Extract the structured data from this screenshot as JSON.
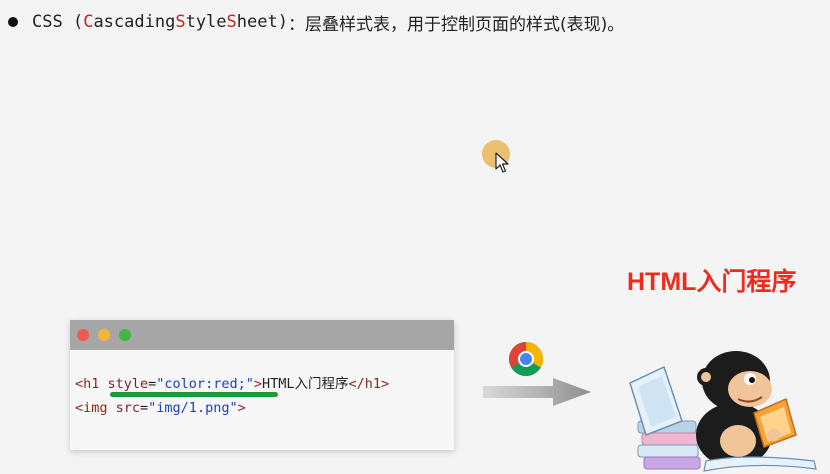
{
  "headline": {
    "parts": [
      "CSS (",
      "C",
      "ascading ",
      "S",
      "tyle ",
      "S",
      "heet)",
      "：层叠样式表，用于控制页面的样式(表现)。"
    ]
  },
  "demo": {
    "title": "HTML入门程序"
  },
  "editor": {
    "line1": {
      "open": "<h1 ",
      "attr": "style",
      "eq": "=",
      "value": "\"color:red;\"",
      "close": ">",
      "text": "HTML入门程序",
      "end": "</h1>"
    },
    "line2": {
      "open": "<img ",
      "attr": "src",
      "eq": "=",
      "value": "\"img/1.png\"",
      "close": ">"
    }
  },
  "colors": {
    "title_red": "#ef2b1f",
    "highlight_red": "#c0271f",
    "underline_green": "#1e9a3b",
    "string_blue": "#1d3fb8"
  },
  "icons": [
    "bullet-icon",
    "mouse-cursor-icon",
    "chrome-icon",
    "arrow-right-icon",
    "mascot-reading-icon"
  ]
}
